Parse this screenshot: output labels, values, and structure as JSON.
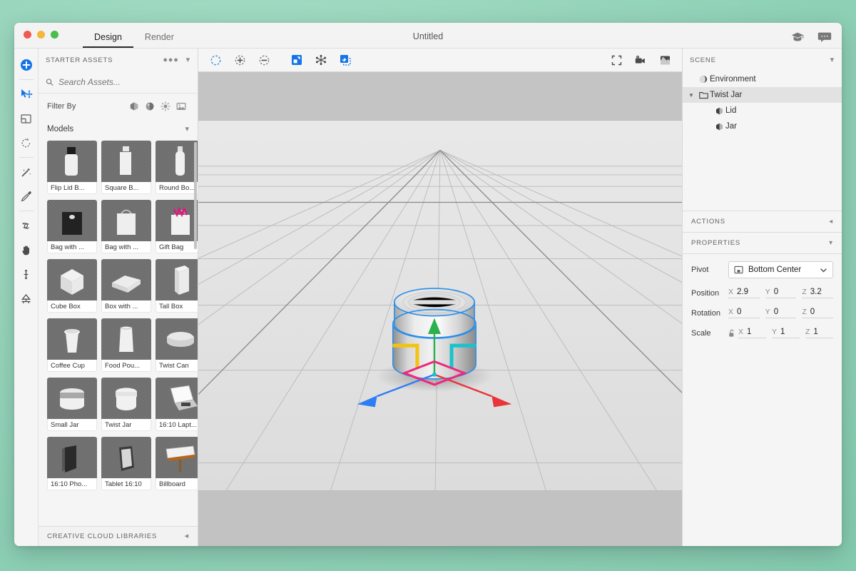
{
  "window": {
    "title": "Untitled",
    "traffic_lights": [
      "close",
      "minimize",
      "zoom"
    ],
    "tabs": [
      {
        "label": "Design",
        "active": true
      },
      {
        "label": "Render",
        "active": false
      }
    ],
    "title_right_icons": [
      "graduation-cap-icon",
      "speech-bubble-icon"
    ]
  },
  "tool_rail": [
    {
      "name": "add-object-tool",
      "icon": "plus-circle-icon",
      "active": true
    },
    {
      "name": "select-move-tool",
      "icon": "move-arrow-icon",
      "active": true
    },
    {
      "name": "magic-transform-tool",
      "icon": "frame-corner-icon",
      "active": false
    },
    {
      "name": "rotate-tool",
      "icon": "rotate-arc-icon",
      "active": false
    },
    {
      "name": "magic-wand-tool",
      "icon": "magic-wand-icon",
      "active": false
    },
    {
      "name": "sampler-tool",
      "icon": "eyedropper-icon",
      "active": false
    },
    {
      "name": "orbit-tool",
      "icon": "orbit-icon",
      "active": false
    },
    {
      "name": "pan-tool",
      "icon": "hand-icon",
      "active": false
    },
    {
      "name": "dolly-tool",
      "icon": "dolly-arrows-icon",
      "active": false
    },
    {
      "name": "camera-tool",
      "icon": "camera-bookmark-icon",
      "active": false
    }
  ],
  "assets_panel": {
    "header": "STARTER ASSETS",
    "header_icons": [
      "more-options-icon",
      "chevron-down-icon"
    ],
    "search": {
      "placeholder": "Search Assets...",
      "value": "",
      "icon": "search-icon"
    },
    "filter": {
      "label": "Filter By",
      "icons": [
        "models-filter-icon",
        "materials-filter-icon",
        "lights-filter-icon",
        "images-filter-icon"
      ]
    },
    "category": {
      "label": "Models",
      "icon": "chevron-down-icon"
    },
    "items": [
      {
        "label": "Flip Lid B...",
        "shape": "bottle-flip-lid"
      },
      {
        "label": "Square B...",
        "shape": "bottle-square"
      },
      {
        "label": "Round Bo...",
        "shape": "bottle-round"
      },
      {
        "label": "Bag with ...",
        "shape": "bag-dark"
      },
      {
        "label": "Bag with ...",
        "shape": "bag-light"
      },
      {
        "label": "Gift Bag",
        "shape": "gift-bag"
      },
      {
        "label": "Cube Box",
        "shape": "cube-box"
      },
      {
        "label": "Box with ...",
        "shape": "flat-box"
      },
      {
        "label": "Tall Box",
        "shape": "tall-box"
      },
      {
        "label": "Coffee Cup",
        "shape": "coffee-cup"
      },
      {
        "label": "Food Pou...",
        "shape": "food-pouch"
      },
      {
        "label": "Twist Can",
        "shape": "twist-can"
      },
      {
        "label": "Small Jar",
        "shape": "small-jar"
      },
      {
        "label": "Twist Jar",
        "shape": "twist-jar"
      },
      {
        "label": "16:10 Lapt...",
        "shape": "laptop"
      },
      {
        "label": "16:10 Pho...",
        "shape": "phone"
      },
      {
        "label": "Tablet 16:10",
        "shape": "tablet"
      },
      {
        "label": "Billboard",
        "shape": "billboard"
      }
    ],
    "footer": {
      "label": "CREATIVE CLOUD LIBRARIES",
      "icon": "chevron-left-icon"
    }
  },
  "viewport_toolbar": {
    "left_tools": [
      {
        "name": "selection-marquee-tool",
        "icon": "dashed-circle-icon",
        "active": false
      },
      {
        "name": "add-to-selection-tool",
        "icon": "dashed-circle-plus-icon",
        "active": false
      },
      {
        "name": "subtract-from-selection-tool",
        "icon": "dashed-circle-minus-icon",
        "active": false
      }
    ],
    "mid_tools": [
      {
        "name": "place-on-ground-tool",
        "icon": "place-object-icon",
        "active": true
      },
      {
        "name": "distribute-tool",
        "icon": "scatter-icon",
        "active": false
      },
      {
        "name": "magic-select-tool",
        "icon": "magic-object-select-icon",
        "active": true
      }
    ],
    "right_tools": [
      {
        "name": "fullscreen-toggle",
        "icon": "fullscreen-icon"
      },
      {
        "name": "camera-bookmarks",
        "icon": "camera-icon"
      },
      {
        "name": "render-preview-toggle",
        "icon": "render-preview-icon"
      }
    ]
  },
  "viewport": {
    "object_name": "Twist Jar",
    "gizmo": {
      "type": "move",
      "axes": [
        {
          "axis": "Y",
          "color": "#2bb24c",
          "direction": "up"
        },
        {
          "axis": "X",
          "color": "#e8353a",
          "direction": "right"
        },
        {
          "axis": "Z",
          "color": "#2f7df5",
          "direction": "left"
        }
      ],
      "planes": [
        {
          "name": "XY",
          "color": "#f2c40f"
        },
        {
          "name": "YZ",
          "color": "#19c2cd"
        },
        {
          "name": "XZ",
          "color": "#ec2a7e"
        }
      ]
    },
    "selection_outline_color": "#2b8fea"
  },
  "scene_panel": {
    "header": "SCENE",
    "header_icon": "chevron-down-icon",
    "items": [
      {
        "label": "Environment",
        "icon": "environment-globe-icon",
        "indent": 0,
        "selected": false,
        "caret": ""
      },
      {
        "label": "Twist Jar",
        "icon": "group-folder-icon",
        "indent": 0,
        "selected": true,
        "caret": "expanded"
      },
      {
        "label": "Lid",
        "icon": "mesh-object-icon",
        "indent": 1,
        "selected": false,
        "caret": ""
      },
      {
        "label": "Jar",
        "icon": "mesh-object-icon",
        "indent": 1,
        "selected": false,
        "caret": ""
      }
    ]
  },
  "actions_panel": {
    "header": "ACTIONS",
    "collapse_icon": "chevron-left-icon"
  },
  "properties_panel": {
    "header": "PROPERTIES",
    "collapse_icon": "chevron-down-icon",
    "pivot": {
      "label": "Pivot",
      "value": "Bottom Center",
      "icon": "pivot-bottom-center-icon",
      "chevron": "chevron-down-icon"
    },
    "position": {
      "label": "Position",
      "x": "2.9",
      "y": "0",
      "z": "3.2"
    },
    "rotation": {
      "label": "Rotation",
      "x": "0",
      "y": "0",
      "z": "0"
    },
    "scale": {
      "label": "Scale",
      "x": "1",
      "y": "1",
      "z": "1",
      "lock_icon": "unlocked-icon"
    },
    "axis_labels": {
      "x": "X",
      "y": "Y",
      "z": "Z"
    }
  }
}
